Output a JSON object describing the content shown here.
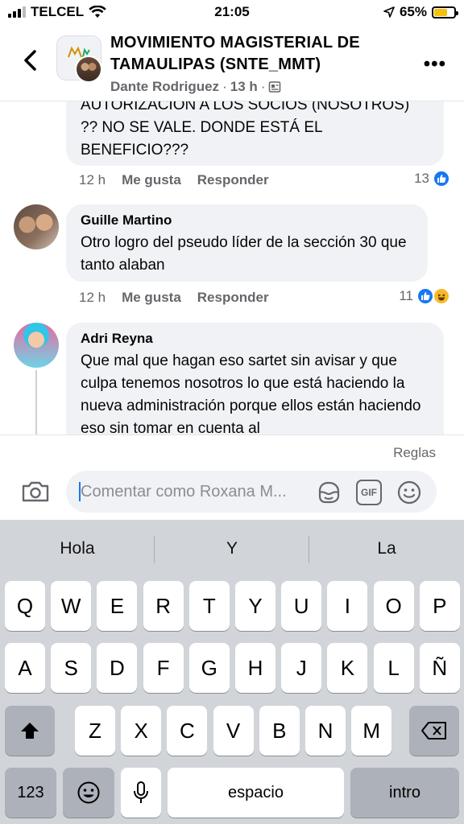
{
  "status_bar": {
    "carrier": "TELCEL",
    "time": "21:05",
    "battery_percent": "65%",
    "battery_level": 0.65,
    "accent": "#f4c20d"
  },
  "header": {
    "title": "MOVIMIENTO MAGISTERIAL DE TAMAULIPAS (SNTE_MMT)",
    "author": "Dante Rodriguez",
    "time": "13 h",
    "back_icon": "chevron-left-icon",
    "more_icon": "more-icon"
  },
  "comments": [
    {
      "author": "",
      "text": "AUTORIZACION A LOS SOCIOS (NOSOTROS) ?? NO SE VALE. DONDE ESTÁ EL BENEFICIO???",
      "time": "12 h",
      "like_label": "Me gusta",
      "reply_label": "Responder",
      "reaction_count": "13",
      "reactions": [
        "like"
      ]
    },
    {
      "author": "Guille Martino",
      "text": "Otro logro del pseudo líder de la sección 30 que tanto alaban",
      "time": "12 h",
      "like_label": "Me gusta",
      "reply_label": "Responder",
      "reaction_count": "11",
      "reactions": [
        "like",
        "haha"
      ]
    },
    {
      "author": "Adri Reyna",
      "text": "Que mal que hagan eso sartet sin avisar y que culpa tenemos nosotros lo que está haciendo la nueva administración porque ellos están haciendo eso sin tomar en cuenta al",
      "time": "",
      "like_label": "",
      "reply_label": "",
      "reaction_count": "",
      "reactions": []
    }
  ],
  "composer": {
    "rules_label": "Reglas",
    "placeholder": "Comentar como Roxana M...",
    "gif_label": "GIF"
  },
  "keyboard": {
    "suggestions": [
      "Hola",
      "Y",
      "La"
    ],
    "row1": [
      "Q",
      "W",
      "E",
      "R",
      "T",
      "Y",
      "U",
      "I",
      "O",
      "P"
    ],
    "row2": [
      "A",
      "S",
      "D",
      "F",
      "G",
      "H",
      "J",
      "K",
      "L",
      "Ñ"
    ],
    "row3": [
      "Z",
      "X",
      "C",
      "V",
      "B",
      "N",
      "M"
    ],
    "numbers_label": "123",
    "space_label": "espacio",
    "return_label": "intro"
  },
  "colors": {
    "facebook_blue": "#1877f2",
    "bubble": "#f0f2f5",
    "secondary_text": "#65676b",
    "keyboard_bg": "#d1d4d9"
  }
}
